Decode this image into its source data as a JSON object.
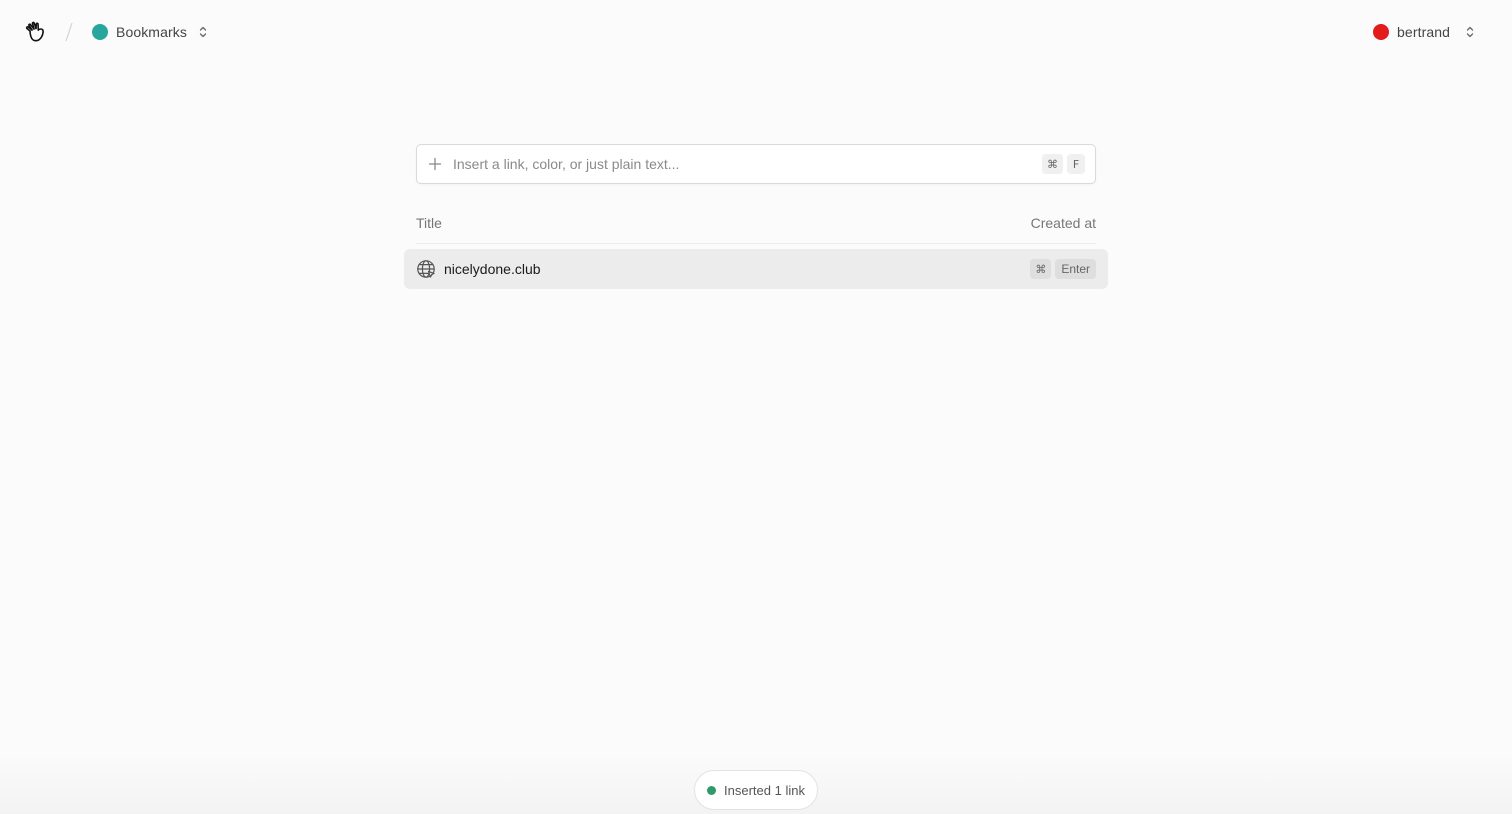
{
  "header": {
    "collection": {
      "label": "Bookmarks",
      "color": "#27a79b"
    },
    "user": {
      "label": "bertrand",
      "color": "#e31b1b"
    }
  },
  "search": {
    "placeholder": "Insert a link, color, or just plain text...",
    "value": "",
    "shortcut": [
      "⌘",
      "F"
    ]
  },
  "table": {
    "columns": [
      "Title",
      "Created at"
    ],
    "rows": [
      {
        "icon": "globe-icon",
        "title": "nicelydone.club",
        "shortcut": [
          "⌘",
          "Enter"
        ]
      }
    ]
  },
  "toast": {
    "text": "Inserted 1 link",
    "status_color": "#2e9a6a"
  }
}
